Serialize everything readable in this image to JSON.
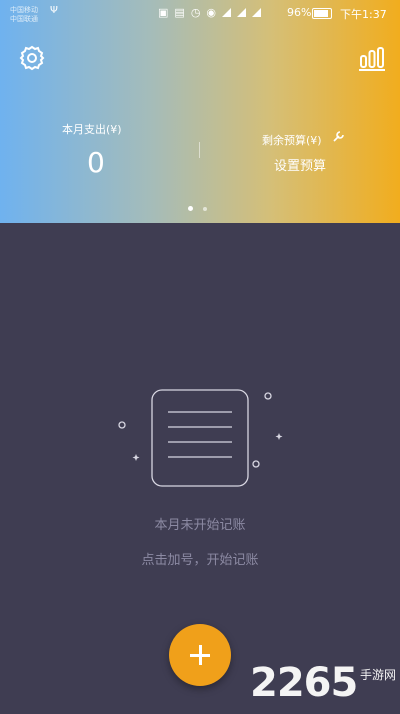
{
  "status_bar": {
    "carrier_1": "中国移动",
    "carrier_2": "中国联通",
    "battery": "96%",
    "time": "下午1:37"
  },
  "header": {
    "month_expense_label": "本月支出(¥)",
    "month_expense_value": "0",
    "remaining_budget_label": "剩余预算(¥)",
    "set_budget_label": "设置预算",
    "page_indicator": {
      "current": 1,
      "total": 2
    }
  },
  "empty_state": {
    "title": "本月未开始记账",
    "hint": "点击加号，开始记账"
  },
  "fab": {
    "label": "+"
  },
  "watermark": {
    "digits": "2265",
    "text": "手游网"
  },
  "colors": {
    "gradient_start": "#6fb2ef",
    "gradient_end": "#f1ad1e",
    "background": "#3f3d52",
    "accent": "#f0a01a",
    "muted_text": "#8c8aa3"
  },
  "icons": {
    "settings": "gear-icon",
    "stats": "bar-chart-icon",
    "budget_edit": "wrench-icon",
    "empty": "notebook-icon"
  }
}
